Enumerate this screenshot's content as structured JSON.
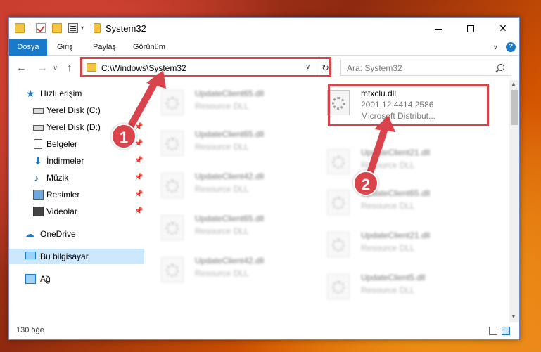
{
  "window": {
    "title": "System32"
  },
  "ribbon": {
    "tabs": [
      {
        "label": "Dosya"
      },
      {
        "label": "Giriş"
      },
      {
        "label": "Paylaş"
      },
      {
        "label": "Görünüm"
      }
    ],
    "help_glyph": "?"
  },
  "navigation": {
    "address_path": "C:\\Windows\\System32",
    "search_placeholder": "Ara: System32"
  },
  "sidebar": {
    "items": [
      {
        "label": "Hızlı erişim",
        "icon": "star-icon"
      },
      {
        "label": "Yerel Disk (C:)",
        "icon": "drive-icon"
      },
      {
        "label": "Yerel Disk (D:)",
        "icon": "drive-icon"
      },
      {
        "label": "Belgeler",
        "icon": "documents-icon"
      },
      {
        "label": "İndirmeler",
        "icon": "download-icon"
      },
      {
        "label": "Müzik",
        "icon": "music-icon"
      },
      {
        "label": "Resimler",
        "icon": "pictures-icon"
      },
      {
        "label": "Videolar",
        "icon": "videos-icon"
      },
      {
        "label": "OneDrive",
        "icon": "cloud-icon"
      },
      {
        "label": "Bu bilgisayar",
        "icon": "computer-icon"
      },
      {
        "label": "Ağ",
        "icon": "network-icon"
      }
    ]
  },
  "files": {
    "highlighted": {
      "name": "mtxclu.dll",
      "version": "2001.12.4414.2586",
      "company": "Microsoft Distribut..."
    },
    "blurred": [
      {
        "name": "UpdateClient65.dll",
        "type": "Resource DLL"
      },
      {
        "name": "UpdateClient65.dll",
        "type": "Resource DLL"
      },
      {
        "name": "UpdateClient21.dll",
        "type": "Resource DLL"
      },
      {
        "name": "UpdateClient42.dll",
        "type": "Resource DLL"
      },
      {
        "name": "UpdateClient65.dll",
        "type": "Resource DLL"
      },
      {
        "name": "UpdateClient65.dll",
        "type": "Resource DLL"
      },
      {
        "name": "UpdateClient21.dll",
        "type": "Resource DLL"
      },
      {
        "name": "UpdateClient42.dll",
        "type": "Resource DLL"
      },
      {
        "name": "UpdateClient5.dll",
        "type": "Resource DLL"
      }
    ]
  },
  "status": {
    "item_count": "130 öğe"
  },
  "annotations": {
    "step1": "1",
    "step2": "2",
    "highlight_color": "#d9434b"
  }
}
